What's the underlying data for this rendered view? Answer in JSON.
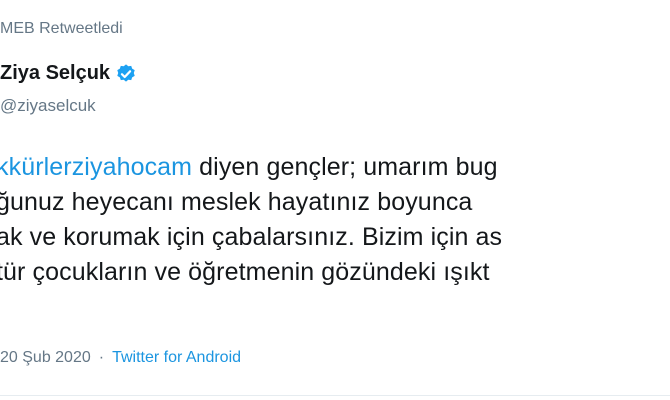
{
  "retweet": {
    "label": "MEB Retweetledi"
  },
  "author": {
    "name": "Ziya Selçuk",
    "handle": "@ziyaselcuk",
    "verified_icon": "verified-badge-icon"
  },
  "tweet": {
    "hashtag": "kkürlerziyahocam",
    "line1_rest": " diyen gençler; umarım bug",
    "line2": "ğunuz heyecanı meslek hayatınız boyunca",
    "line3": "ak ve korumak için çabalarsınız. Bizim için as",
    "line4": "tür çocukların ve öğretmenin gözündeki ışıkt"
  },
  "meta": {
    "timestamp": "20 Şub 2020",
    "separator": "·",
    "source": "Twitter for Android"
  },
  "colors": {
    "accent": "#1b95e0",
    "text": "#14171a",
    "secondary": "#657786"
  }
}
